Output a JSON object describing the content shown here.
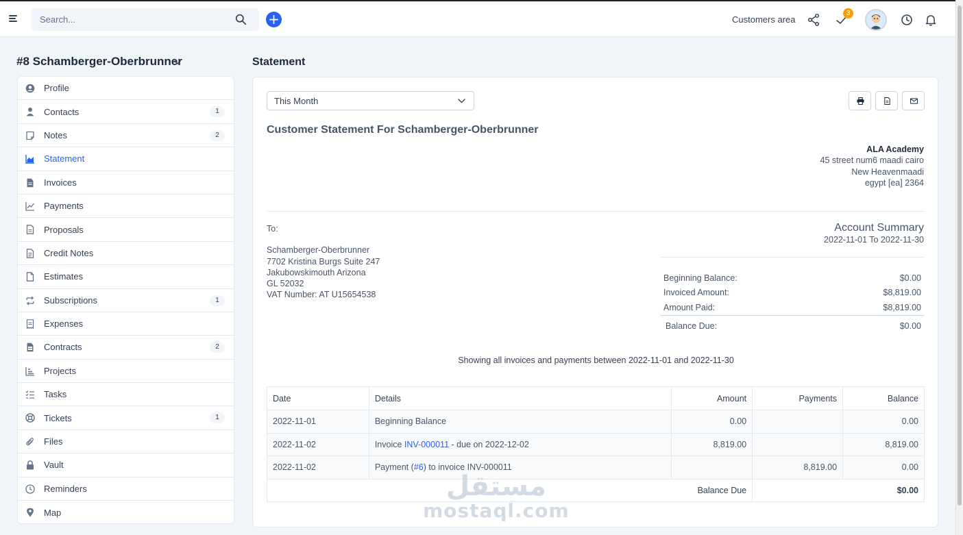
{
  "topbar": {
    "search_placeholder": "Search...",
    "add_symbol": "+",
    "customers_area": "Customers area",
    "tasks_badge": "3"
  },
  "client": {
    "title": "#8 Schamberger-Oberbrunner"
  },
  "sidebar": {
    "items": [
      {
        "label": "Profile",
        "icon": "user-circle-icon",
        "count": ""
      },
      {
        "label": "Contacts",
        "icon": "user-icon",
        "count": "1"
      },
      {
        "label": "Notes",
        "icon": "note-icon",
        "count": "2"
      },
      {
        "label": "Statement",
        "icon": "area-chart-icon",
        "count": "",
        "active": true
      },
      {
        "label": "Invoices",
        "icon": "file-text-icon",
        "count": ""
      },
      {
        "label": "Payments",
        "icon": "line-chart-icon",
        "count": ""
      },
      {
        "label": "Proposals",
        "icon": "file-icon",
        "count": ""
      },
      {
        "label": "Credit Notes",
        "icon": "file-lines-icon",
        "count": ""
      },
      {
        "label": "Estimates",
        "icon": "file-outline-icon",
        "count": ""
      },
      {
        "label": "Subscriptions",
        "icon": "repeat-icon",
        "count": "1"
      },
      {
        "label": "Expenses",
        "icon": "receipt-icon",
        "count": ""
      },
      {
        "label": "Contracts",
        "icon": "contract-icon",
        "count": "2"
      },
      {
        "label": "Projects",
        "icon": "bar-chart-icon",
        "count": ""
      },
      {
        "label": "Tasks",
        "icon": "list-check-icon",
        "count": ""
      },
      {
        "label": "Tickets",
        "icon": "life-ring-icon",
        "count": "1"
      },
      {
        "label": "Files",
        "icon": "paperclip-icon",
        "count": ""
      },
      {
        "label": "Vault",
        "icon": "lock-icon",
        "count": ""
      },
      {
        "label": "Reminders",
        "icon": "clock-icon",
        "count": ""
      },
      {
        "label": "Map",
        "icon": "map-marker-icon",
        "count": ""
      }
    ]
  },
  "main": {
    "heading": "Statement",
    "period": "This Month",
    "statement_title": "Customer Statement For Schamberger-Oberbrunner",
    "company": {
      "name": "ALA Academy",
      "line1": "45 street num6 maadi cairo",
      "line2": "New Heavenmaadi",
      "line3": "egypt [ea] 2364"
    },
    "to": {
      "label": "To:",
      "name": "Schamberger-Oberbrunner",
      "line1": "7702 Kristina Burgs Suite 247",
      "line2": "Jakubowskimouth Arizona",
      "line3": "GL 52032",
      "vat": "VAT Number: AT U15654538"
    },
    "account_summary": {
      "title": "Account Summary",
      "range": "2022-11-01 To 2022-11-30",
      "beginning_label": "Beginning Balance:",
      "beginning_value": "$0.00",
      "invoiced_label": "Invoiced Amount:",
      "invoiced_value": "$8,819.00",
      "paid_label": "Amount Paid:",
      "paid_value": "$8,819.00",
      "due_label": "Balance Due:",
      "due_value": "$0.00"
    },
    "showing_text": "Showing all invoices and payments between 2022-11-01 and 2022-11-30",
    "table": {
      "headers": [
        "Date",
        "Details",
        "Amount",
        "Payments",
        "Balance"
      ],
      "rows": [
        {
          "date": "2022-11-01",
          "details": "Beginning Balance",
          "amount": "0.00",
          "payments": "",
          "balance": "0.00"
        },
        {
          "date": "2022-11-02",
          "pre": "Invoice ",
          "link": "INV-000011",
          "post": " - due on 2022-12-02",
          "amount": "8,819.00",
          "payments": "",
          "balance": "8,819.00"
        },
        {
          "date": "2022-11-02",
          "pre": "Payment (",
          "link": "#6",
          "post": ") to invoice INV-000011",
          "amount": "",
          "payments": "8,819.00",
          "balance": "0.00"
        }
      ],
      "total_label": "Balance Due",
      "total_value": "$0.00"
    }
  },
  "watermark": {
    "arabic": "مستقل",
    "latin": "mostaql.com"
  },
  "colors": {
    "accent": "#2563eb",
    "badge": "#f59e0b"
  }
}
